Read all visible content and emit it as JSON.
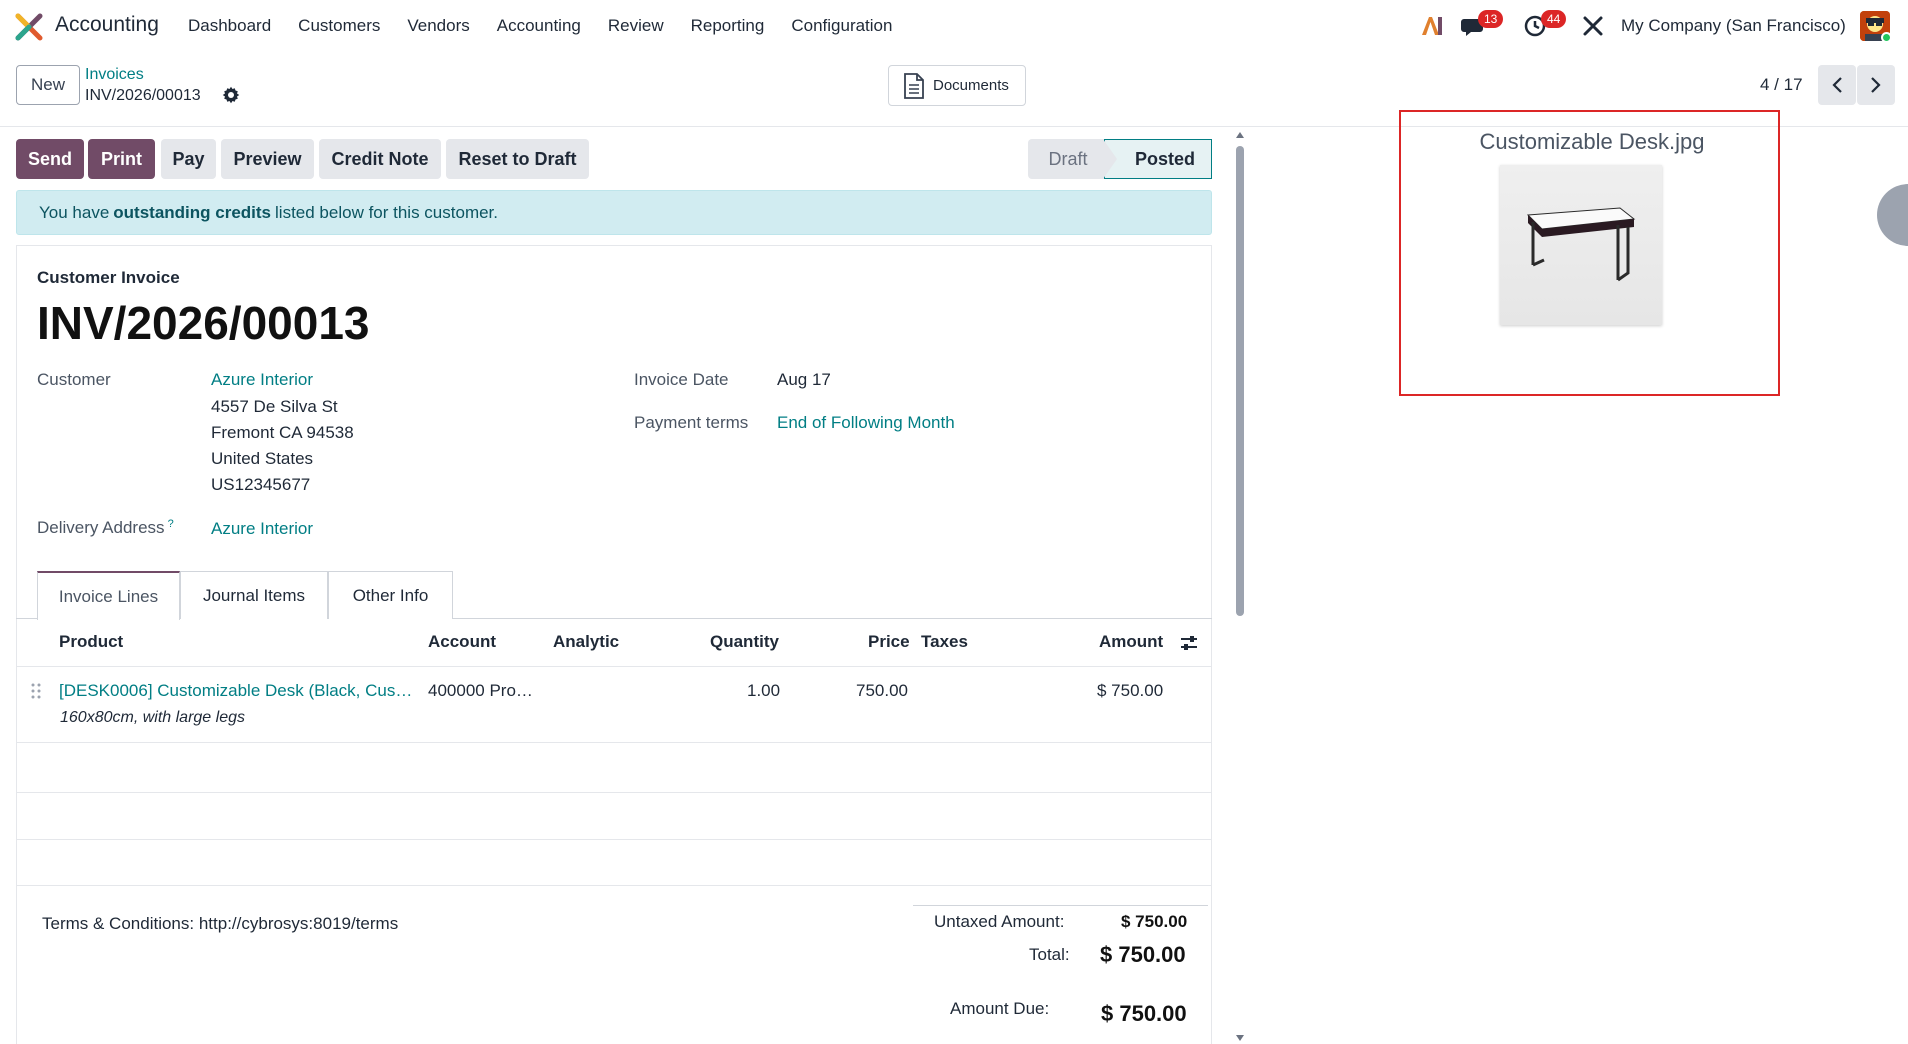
{
  "app": {
    "name": "Accounting"
  },
  "menu": [
    "Dashboard",
    "Customers",
    "Vendors",
    "Accounting",
    "Review",
    "Reporting",
    "Configuration"
  ],
  "systray": {
    "messages_count": "13",
    "activities_count": "44",
    "company": "My Company (San Francisco)"
  },
  "control": {
    "new_label": "New",
    "breadcrumb_parent": "Invoices",
    "breadcrumb_current": "INV/2026/00013",
    "documents_label": "Documents",
    "pager": "4 / 17"
  },
  "actions": {
    "send": "Send",
    "print": "Print",
    "pay": "Pay",
    "preview": "Preview",
    "credit_note": "Credit Note",
    "reset_to_draft": "Reset to Draft"
  },
  "status": {
    "draft": "Draft",
    "posted": "Posted",
    "current": "Posted"
  },
  "alert": {
    "prefix": "You have",
    "bold": "outstanding credits",
    "suffix": "listed below for this customer."
  },
  "invoice": {
    "type": "Customer Invoice",
    "name": "INV/2026/00013",
    "customer_label": "Customer",
    "customer": "Azure Interior",
    "address": [
      "4557 De Silva St",
      "Fremont CA 94538",
      "United States",
      "US12345677"
    ],
    "delivery_label": "Delivery Address",
    "delivery_help": "?",
    "delivery": "Azure Interior",
    "date_label": "Invoice Date",
    "date": "Aug 17",
    "terms_label": "Payment terms",
    "terms": "End of Following Month"
  },
  "tabs": [
    "Invoice Lines",
    "Journal Items",
    "Other Info"
  ],
  "lines": {
    "headers": {
      "product": "Product",
      "account": "Account",
      "analytic": "Analytic",
      "quantity": "Quantity",
      "price": "Price",
      "taxes": "Taxes",
      "amount": "Amount"
    },
    "rows": [
      {
        "product": "[DESK0006] Customizable Desk (Black, Cus…",
        "description": "160x80cm, with large legs",
        "account": "400000 Pro…",
        "analytic": "",
        "quantity": "1.00",
        "price": "750.00",
        "taxes": "",
        "amount": "$ 750.00"
      }
    ]
  },
  "footer": {
    "terms": "Terms & Conditions: http://cybrosys:8019/terms",
    "untaxed_label": "Untaxed Amount:",
    "untaxed": "$ 750.00",
    "total_label": "Total:",
    "total": "$ 750.00",
    "due_label": "Amount Due:",
    "due": "$ 750.00"
  },
  "attachment": {
    "title": "Customizable Desk.jpg"
  },
  "colors": {
    "brand": "#714b67",
    "link": "#017e84",
    "badge": "#dc2626",
    "highlight": "#dc2626"
  }
}
